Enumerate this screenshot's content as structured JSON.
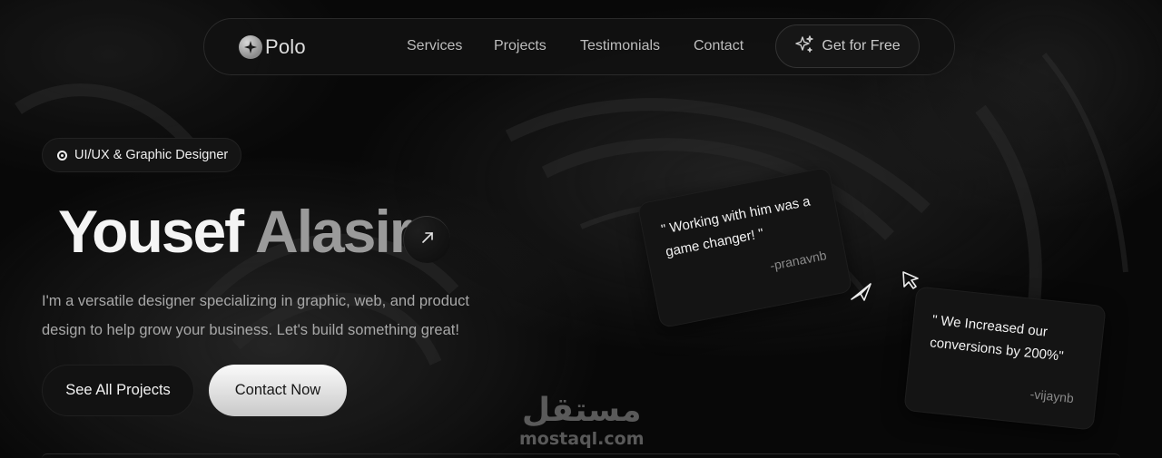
{
  "nav": {
    "brand": "Polo",
    "links": [
      "Services",
      "Projects",
      "Testimonials",
      "Contact"
    ],
    "cta_label": "Get for Free"
  },
  "hero": {
    "badge": "UI/UX & Graphic Designer",
    "first_name": "Yousef",
    "last_name": "Alasir",
    "description": "I'm a versatile designer specializing in graphic, web, and product design to help grow your business. Let's build something great!",
    "primary_button": "See All Projects",
    "secondary_button": "Contact Now"
  },
  "testimonials": [
    {
      "quote": "\" Working with him was a game changer! \"",
      "author": "-pranavnb"
    },
    {
      "quote": "\" We Increased our conversions by 200%\"",
      "author": "-vijaynb"
    }
  ],
  "watermark": {
    "arabic": "مستقل",
    "latin": "mostaql.com"
  },
  "icons": {
    "brand": "sparkle-logo-icon",
    "cta": "sparkles-icon",
    "name_link": "arrow-up-right-icon",
    "cursors": [
      "send-arrow-icon",
      "mouse-pointer-icon"
    ]
  }
}
